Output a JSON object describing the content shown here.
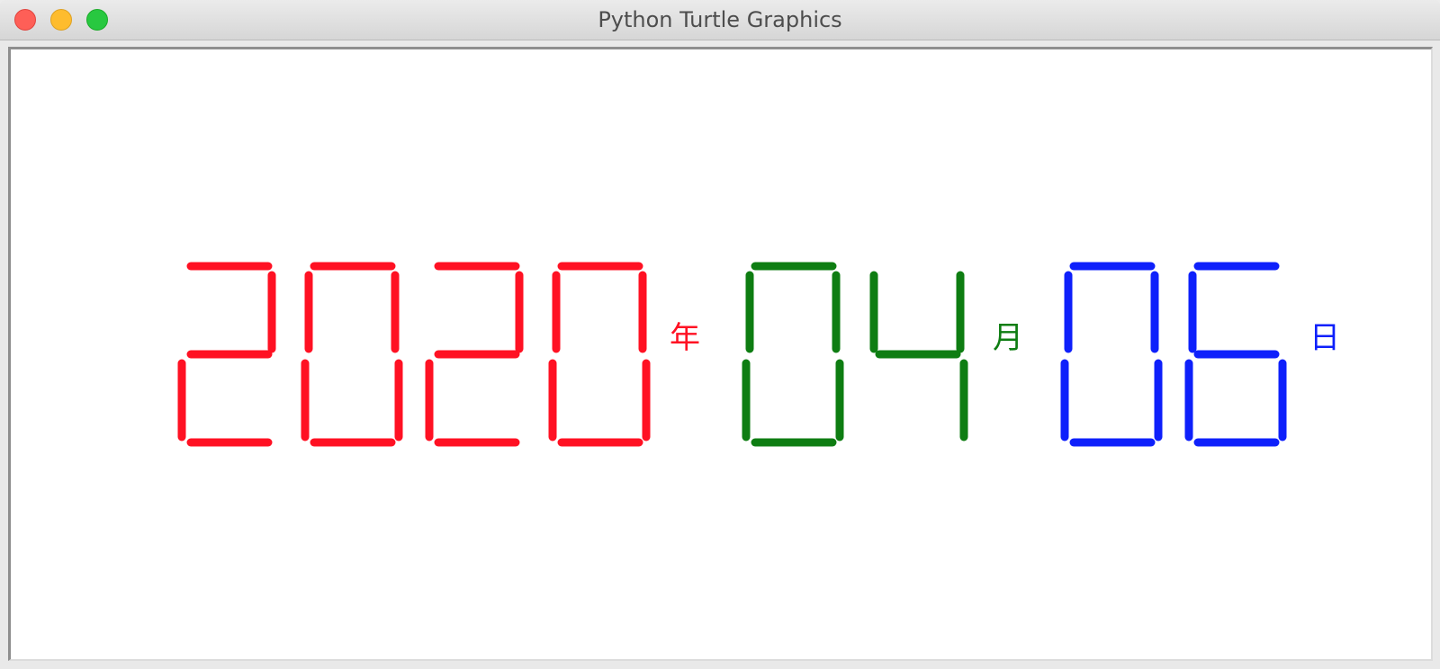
{
  "window": {
    "title": "Python Turtle Graphics"
  },
  "display": {
    "groups": [
      {
        "name": "year",
        "digits": "2020",
        "unit": "年",
        "color": "#ff1123"
      },
      {
        "name": "month",
        "digits": "04",
        "unit": "月",
        "color": "#0e7d12"
      },
      {
        "name": "day",
        "digits": "06",
        "unit": "日",
        "color": "#0e20fb"
      }
    ]
  }
}
